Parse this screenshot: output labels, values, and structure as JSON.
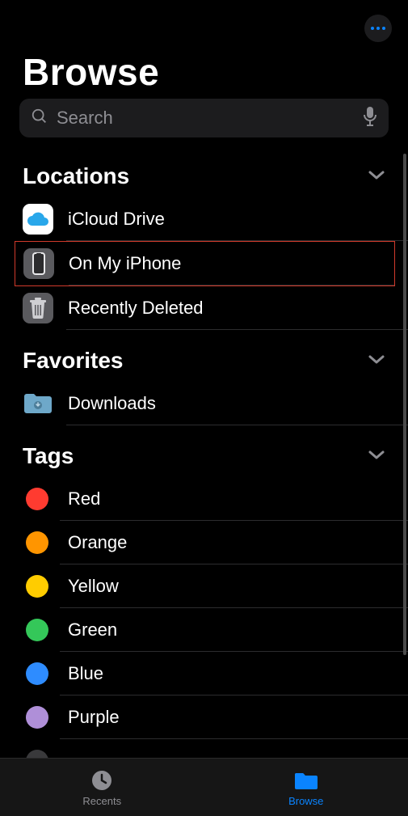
{
  "header": {
    "title": "Browse"
  },
  "search": {
    "placeholder": "Search"
  },
  "sections": {
    "locations": {
      "title": "Locations",
      "items": [
        {
          "label": "iCloud Drive"
        },
        {
          "label": "On My iPhone"
        },
        {
          "label": "Recently Deleted"
        }
      ]
    },
    "favorites": {
      "title": "Favorites",
      "items": [
        {
          "label": "Downloads"
        }
      ]
    },
    "tags": {
      "title": "Tags",
      "items": [
        {
          "label": "Red",
          "color": "#ff3b30"
        },
        {
          "label": "Orange",
          "color": "#ff9500"
        },
        {
          "label": "Yellow",
          "color": "#ffcc00"
        },
        {
          "label": "Green",
          "color": "#34c759"
        },
        {
          "label": "Blue",
          "color": "#2e8cff"
        },
        {
          "label": "Purple",
          "color": "#af8fd8"
        }
      ]
    }
  },
  "tabbar": {
    "items": [
      {
        "label": "Recents",
        "active": false
      },
      {
        "label": "Browse",
        "active": true
      }
    ]
  }
}
